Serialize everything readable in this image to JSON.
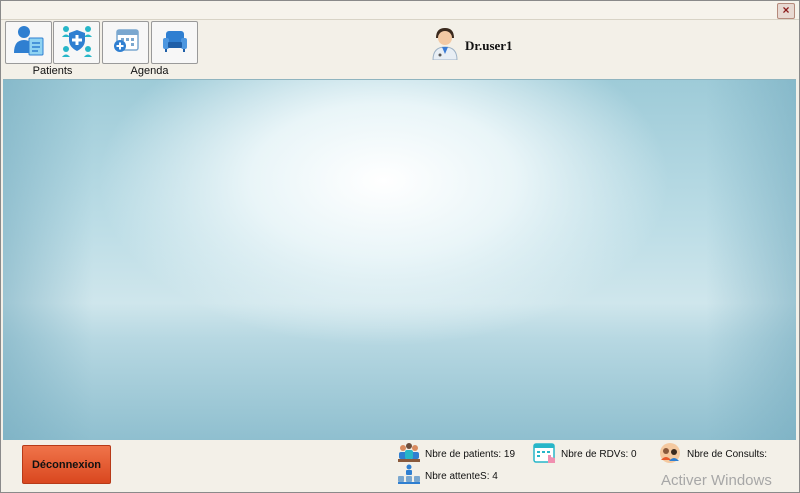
{
  "toolbar": {
    "patients_label": "Patients",
    "agenda_label": "Agenda"
  },
  "user": {
    "name": "Dr.user1"
  },
  "footer": {
    "logout_label": "Déconnexion",
    "stats": {
      "patients": "Nbre de patients: 19",
      "rdvs": "Nbre de RDVs: 0",
      "consults": "Nbre de Consults:",
      "attentes": "Nbre attenteS: 4"
    }
  },
  "watermark": "Activer Windows",
  "titlebar": {
    "close_glyph": "×"
  },
  "colors": {
    "accent": "#e85a2c",
    "icon_blue": "#2f7fd1",
    "icon_teal": "#27b6c8"
  },
  "icons": [
    "patient-file-icon",
    "medical-team-shield-icon",
    "calendar-add-icon",
    "armchair-icon",
    "doctor-avatar-icon",
    "patients-group-icon",
    "calendar-touch-icon",
    "consultation-icon",
    "waiting-queue-icon"
  ]
}
